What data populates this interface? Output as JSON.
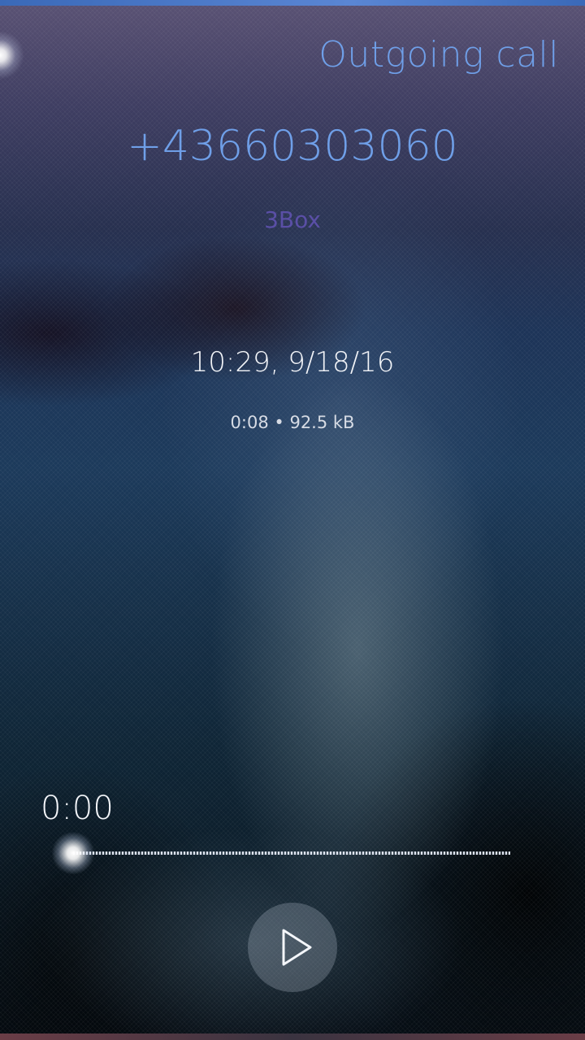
{
  "header": {
    "title": "Outgoing call"
  },
  "call": {
    "number": "+43660303060",
    "carrier": "3Box",
    "datetime": "10:29, 9/18/16",
    "duration": "0:08",
    "separator": "•",
    "size": "92.5 kB"
  },
  "player": {
    "elapsed": "0:00",
    "progress": 0.0,
    "play_icon": "play-icon"
  },
  "colors": {
    "accent": "#6f9fe8",
    "carrier": "#5a4fa6",
    "text_primary": "#f2f4f8"
  }
}
